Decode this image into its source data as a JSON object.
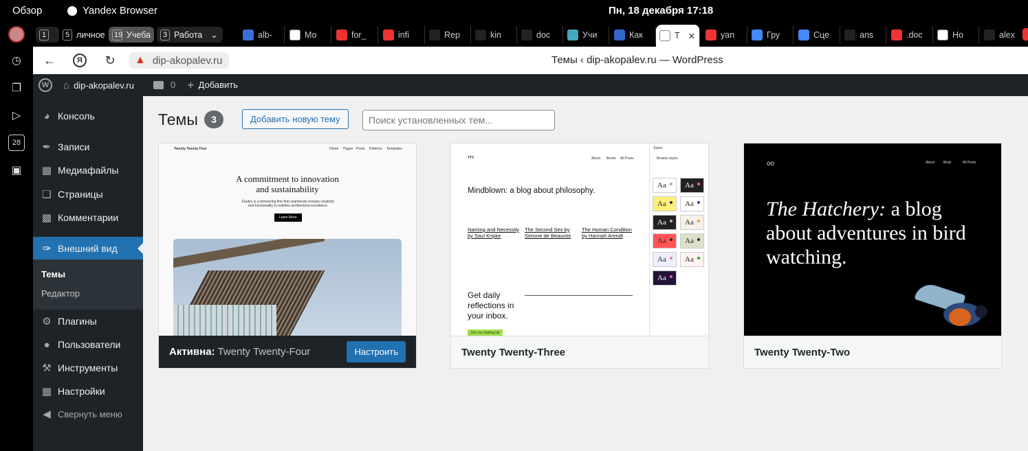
{
  "system": {
    "overview": "Обзор",
    "app_name": "Yandex Browser",
    "clock": "Пн, 18 декабря  17:18"
  },
  "tab_groups": [
    {
      "num": "1",
      "label": ""
    },
    {
      "num": "5",
      "label": "личное"
    },
    {
      "num": "19",
      "label": "Учеба"
    },
    {
      "num": "3",
      "label": "Работа"
    }
  ],
  "tabs": [
    "alb-",
    "Мо",
    "for_",
    "infi",
    "Rep",
    "kin",
    "doc",
    "Учи",
    "Как",
    "T",
    "yan",
    "Гру",
    "Сце",
    "ans",
    ".doc",
    "Но",
    "alex"
  ],
  "toolbar": {
    "url": "dip-akopalev.ru",
    "page_title": "Темы ‹ dip-akopalev.ru — WordPress"
  },
  "adminbar": {
    "site": "dip-akopalev.ru",
    "comments": "0",
    "new": "Добавить"
  },
  "menu": {
    "console": "Консоль",
    "posts": "Записи",
    "media": "Медиафайлы",
    "pages": "Страницы",
    "comments": "Комментарии",
    "appearance": "Внешний вид",
    "themes": "Темы",
    "editor": "Редактор",
    "plugins": "Плагины",
    "users": "Пользователи",
    "tools": "Инструменты",
    "settings": "Настройки",
    "collapse": "Свернуть меню"
  },
  "page": {
    "title": "Темы",
    "count": "3",
    "add_button": "Добавить новую тему",
    "search_placeholder": "Поиск установленных тем..."
  },
  "themes": [
    {
      "active_label": "Активна:",
      "name": "Twenty Twenty-Four",
      "customize": "Настроить",
      "preview": {
        "brand": "Twenty Twenty Four",
        "nav": [
          "Home",
          "Pages",
          "Posts",
          "Patterns",
          "Templates"
        ],
        "headline": "A commitment to innovation and sustainability",
        "text": "Études is a pioneering firm that seamlessly merges creativity and functionality to redefine architectural excellence.",
        "button": "Learn More"
      }
    },
    {
      "name": "Twenty Twenty-Three",
      "preview": {
        "brand": "TT3",
        "nav": [
          "About",
          "Books",
          "All Posts"
        ],
        "headline": "Mindblown: a blog about philosophy.",
        "posts": [
          "Naming and Necessity by Saul Kripke",
          "The Second Sex by Simone de Beauvoir",
          "The Human Condition by Hannah Arendt"
        ],
        "cta": "Get daily reflections in your inbox.",
        "cta_btn": "Join our mailing list",
        "styles_title": "Styles",
        "styles_sub": "Browse styles",
        "aa": "Aa"
      }
    },
    {
      "name": "Twenty Twenty-Two",
      "preview": {
        "nav": [
          "About",
          "Birds",
          "All Posts"
        ],
        "headline_em": "The Hatchery:",
        "headline": "a blog about adventures in bird watching."
      }
    }
  ],
  "colors": {
    "admin_dark": "#1d2327",
    "accent": "#2271b1",
    "bg": "#f0f0f1"
  }
}
